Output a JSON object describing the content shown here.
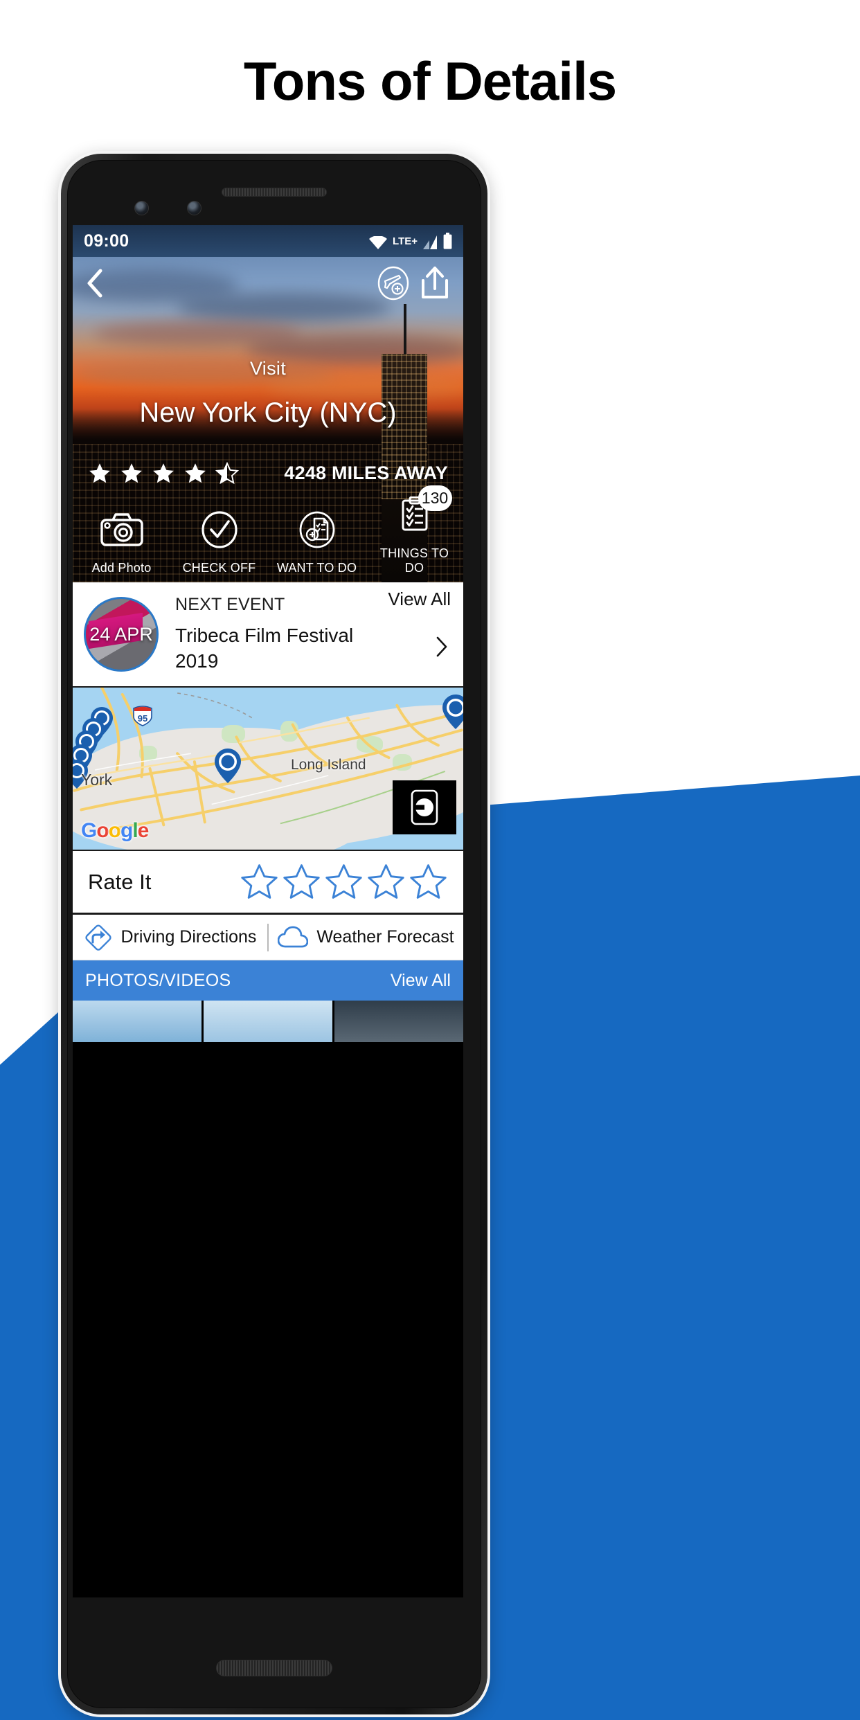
{
  "headline": "Tons of Details",
  "colors": {
    "brand_blue": "#1669c1",
    "accent_blue": "#3b82d6",
    "star_outline": "#3b82d6",
    "power_button": "#e2693a"
  },
  "phone": {
    "status_bar": {
      "time": "09:00",
      "network_label": "LTE+",
      "icons": [
        "wifi-icon",
        "lte-label",
        "signal-icon",
        "battery-icon"
      ]
    },
    "hero": {
      "back_icon": "back-chevron-icon",
      "add_trip_icon": "airplane-add-icon",
      "share_icon": "share-upload-icon",
      "kicker": "Visit",
      "title": "New York City (NYC)",
      "rating": 4.5,
      "rating_max": 5,
      "distance": "4248 MILES AWAY",
      "actions": [
        {
          "icon": "camera-icon",
          "label": "Add Photo",
          "badge": null
        },
        {
          "icon": "check-circle-icon",
          "label": "CHECK OFF",
          "badge": null
        },
        {
          "icon": "document-add-icon",
          "label": "WANT TO DO",
          "badge": null
        },
        {
          "icon": "clipboard-list-icon",
          "label": "THINGS TO DO",
          "badge": "130"
        }
      ]
    },
    "event_card": {
      "date_badge": "24 APR",
      "kicker": "NEXT EVENT",
      "title": "Tribeca Film Festival 2019",
      "view_all": "View All",
      "chevron_icon": "chevron-right-icon"
    },
    "map_card": {
      "labels": {
        "long_island": "Long Island",
        "new_york": "York",
        "highway_shield": "95",
        "attribution": "Google"
      },
      "attribution_letters": [
        "G",
        "o",
        "o",
        "g",
        "l",
        "e"
      ],
      "ride_button_icon": "uber-icon"
    },
    "rate_row": {
      "label": "Rate It",
      "stars": 5,
      "filled": 0
    },
    "links_row": [
      {
        "icon": "turn-right-diamond-icon",
        "label": "Driving Directions"
      },
      {
        "icon": "cloud-icon",
        "label": "Weather Forecast"
      }
    ],
    "photos_bar": {
      "title": "PHOTOS/VIDEOS",
      "view_all": "View All"
    }
  }
}
